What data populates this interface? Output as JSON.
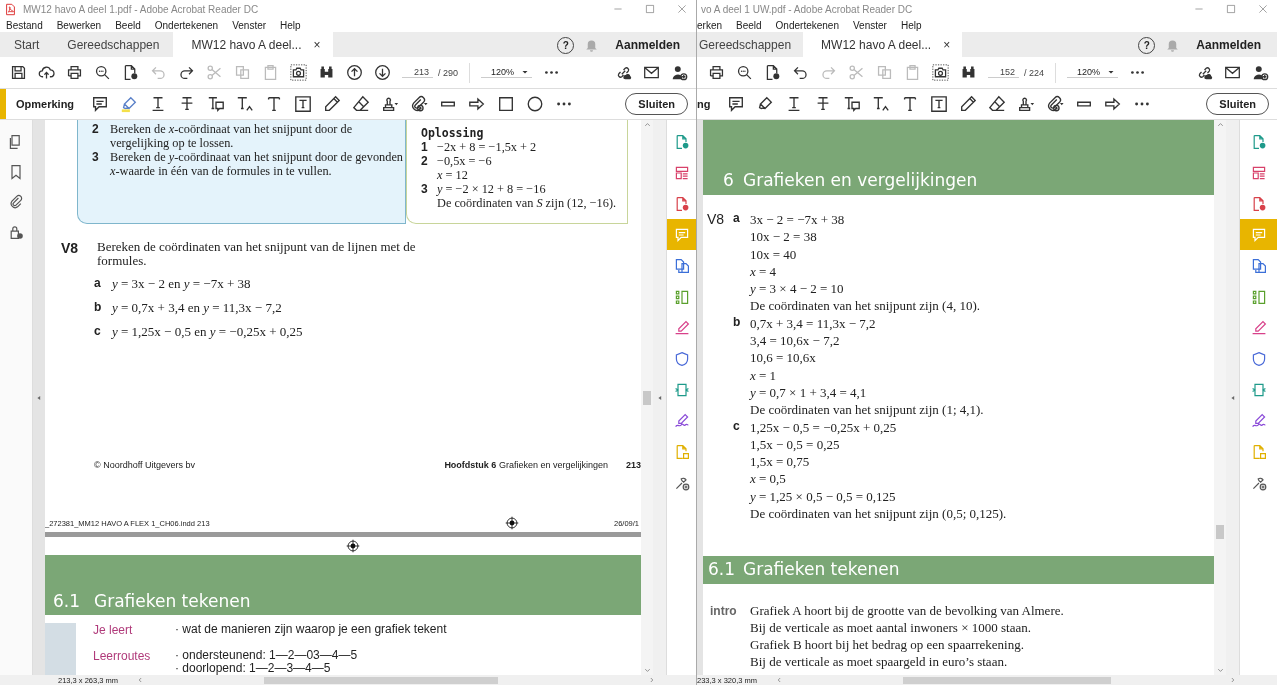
{
  "windows": [
    {
      "title": "MW12 havo A deel 1.pdf - Adobe Acrobat Reader DC",
      "app_icon": true,
      "menu": [
        "Bestand",
        "Bewerken",
        "Beeld",
        "Ondertekenen",
        "Venster",
        "Help"
      ],
      "tabs": [
        {
          "label": "Start",
          "selected": false
        },
        {
          "label": "Gereedschappen",
          "selected": false
        },
        {
          "label": "MW12 havo A deel...",
          "selected": true,
          "close": "×"
        }
      ],
      "help": "?",
      "sign_in": "Aanmelden",
      "tools": [
        {
          "kind": "save",
          "disabled": false
        },
        {
          "kind": "upload",
          "disabled": false
        },
        {
          "kind": "print",
          "disabled": false
        },
        {
          "kind": "search",
          "disabled": false
        },
        {
          "kind": "pdfcheck",
          "disabled": false
        },
        {
          "kind": "undo",
          "disabled": true
        },
        {
          "kind": "redo",
          "disabled": false
        },
        {
          "kind": "cut",
          "disabled": true
        },
        {
          "kind": "copy",
          "disabled": true
        },
        {
          "kind": "paste",
          "disabled": true
        },
        {
          "kind": "snapshot",
          "disabled": false
        },
        {
          "kind": "find",
          "disabled": false
        },
        {
          "kind": "prev",
          "disabled": false
        },
        {
          "kind": "next",
          "disabled": false
        }
      ],
      "page": "213",
      "page_count": "/ 290",
      "zoom": "120%",
      "comment_toolbar": {
        "label": "Opmerking",
        "marker": true,
        "close": "Sluiten"
      },
      "annotation_tools": [
        {
          "kind": "comment",
          "selected": false
        },
        {
          "kind": "highlight",
          "selected": true
        },
        {
          "kind": "underline",
          "selected": false
        },
        {
          "kind": "strike",
          "selected": false
        },
        {
          "kind": "replace",
          "selected": false
        },
        {
          "kind": "insert",
          "selected": false
        },
        {
          "kind": "text",
          "selected": false
        },
        {
          "kind": "textbox",
          "selected": false
        },
        {
          "kind": "pencil",
          "selected": false
        },
        {
          "kind": "eraser",
          "selected": false
        },
        {
          "kind": "stamp",
          "selected": false
        },
        {
          "kind": "attach",
          "selected": false
        },
        {
          "kind": "line",
          "selected": false
        },
        {
          "kind": "arrow",
          "selected": false
        },
        {
          "kind": "rect",
          "selected": false
        },
        {
          "kind": "ellipse",
          "selected": false
        },
        {
          "kind": "more",
          "selected": false
        }
      ],
      "nav_pane": [
        {
          "kind": "pages"
        },
        {
          "kind": "bookmark"
        },
        {
          "kind": "clip"
        },
        {
          "kind": "security"
        }
      ],
      "tool_pane": [
        {
          "kind": "export",
          "selected": false
        },
        {
          "kind": "edit",
          "selected": false
        },
        {
          "kind": "create",
          "selected": false
        },
        {
          "kind": "comment",
          "selected": true
        },
        {
          "kind": "combine",
          "selected": false
        },
        {
          "kind": "organize",
          "selected": false
        },
        {
          "kind": "fill",
          "selected": false
        },
        {
          "kind": "protect",
          "selected": false
        },
        {
          "kind": "optimize",
          "selected": false
        },
        {
          "kind": "sign",
          "selected": false
        },
        {
          "kind": "moretools",
          "selected": false
        },
        {
          "kind": "custom",
          "selected": false
        }
      ],
      "status": "213,3 x 263,3 mm",
      "document": {
        "kind": "textbook",
        "steps": [
          {
            "num": "2",
            "text": "Bereken de *x*-coördinaat van het snijpunt door de vergelijking op te lossen."
          },
          {
            "num": "3",
            "text": "Bereken de *y*-coördinaat van het snijpunt door de gevonden *x*-waarde in één van de formules in te vullen."
          }
        ],
        "solution": {
          "title": "Oplossing",
          "lines": [
            {
              "num": "1",
              "text": "−2x + 8 = −1,5x + 2"
            },
            {
              "num": "2",
              "text": "−0,5x = −6"
            },
            {
              "text": "*x* = 12"
            },
            {
              "num": "3",
              "text": "*y* = −2 × 12 + 8 = −16"
            },
            {
              "text": "De coördinaten van *S* zijn (12, −16)."
            }
          ]
        },
        "exercise": {
          "number": "V8",
          "text": "Bereken de coördinaten van het snijpunt van de lijnen met de formules.",
          "parts": [
            {
              "letter": "a",
              "text": "*y* = 3x − 2 en *y* = −7x + 38"
            },
            {
              "letter": "b",
              "text": "*y* = 0,7x + 3,4 en *y* = 11,3x − 7,2"
            },
            {
              "letter": "c",
              "text": "*y* = 1,25x − 0,5 en *y* = −0,25x + 0,25"
            }
          ]
        },
        "footer": {
          "copyright": "© Noordhoff Uitgevers bv",
          "chapter": "**Hoofdstuk 6** Grafieken en vergelijkingen",
          "page": "213"
        },
        "slug": {
          "file": "_272381_MM12 HAVO A FLEX 1_CH06.indd   213",
          "date": "26/09/1"
        },
        "section": {
          "number": "6.1",
          "title": "Grafieken tekenen"
        },
        "goals": [
          {
            "label": "Je leert",
            "lines": [
              "· wat de manieren zijn waarop je een grafiek tekent"
            ]
          },
          {
            "label": "Leerroutes",
            "lines": [
              "· ondersteunend: 1—2—03—4—5",
              "· doorlopend:       1—2—3—4—5"
            ]
          }
        ]
      }
    },
    {
      "title": "vo A deel 1 UW.pdf - Adobe Acrobat Reader DC",
      "app_icon": false,
      "menu": [
        "erken",
        "Beeld",
        "Ondertekenen",
        "Venster",
        "Help"
      ],
      "tabs": [
        {
          "label": "Gereedschappen",
          "selected": false
        },
        {
          "label": "MW12 havo A deel...",
          "selected": true,
          "close": "×"
        }
      ],
      "help": "?",
      "sign_in": "Aanmelden",
      "tools": [
        {
          "kind": "print",
          "disabled": false
        },
        {
          "kind": "search",
          "disabled": false
        },
        {
          "kind": "pdfcheck",
          "disabled": false
        },
        {
          "kind": "undo",
          "disabled": false
        },
        {
          "kind": "redo",
          "disabled": true
        },
        {
          "kind": "cut",
          "disabled": true
        },
        {
          "kind": "copy",
          "disabled": true
        },
        {
          "kind": "paste",
          "disabled": true
        },
        {
          "kind": "snapshot",
          "disabled": false
        },
        {
          "kind": "find",
          "disabled": false
        }
      ],
      "page": "152",
      "page_count": "/ 224",
      "zoom": "120%",
      "comment_toolbar": {
        "label": "ng",
        "marker": false,
        "close": "Sluiten"
      },
      "annotation_tools": [
        {
          "kind": "comment",
          "selected": false
        },
        {
          "kind": "highlight",
          "selected": false
        },
        {
          "kind": "underline",
          "selected": false
        },
        {
          "kind": "strike",
          "selected": false
        },
        {
          "kind": "replace",
          "selected": false
        },
        {
          "kind": "insert",
          "selected": false
        },
        {
          "kind": "text",
          "selected": false
        },
        {
          "kind": "textbox",
          "selected": false
        },
        {
          "kind": "pencil",
          "selected": false
        },
        {
          "kind": "eraser",
          "selected": false
        },
        {
          "kind": "stamp",
          "selected": false
        },
        {
          "kind": "attach",
          "selected": false
        },
        {
          "kind": "line",
          "selected": false
        },
        {
          "kind": "arrow",
          "selected": false
        },
        {
          "kind": "more",
          "selected": false
        }
      ],
      "tool_pane": [
        {
          "kind": "export",
          "selected": false
        },
        {
          "kind": "edit",
          "selected": false
        },
        {
          "kind": "create",
          "selected": false
        },
        {
          "kind": "comment",
          "selected": true
        },
        {
          "kind": "combine",
          "selected": false
        },
        {
          "kind": "organize",
          "selected": false
        },
        {
          "kind": "fill",
          "selected": false
        },
        {
          "kind": "protect",
          "selected": false
        },
        {
          "kind": "optimize",
          "selected": false
        },
        {
          "kind": "sign",
          "selected": false
        },
        {
          "kind": "moretools",
          "selected": false
        },
        {
          "kind": "custom",
          "selected": false
        }
      ],
      "status": "233,3 x 320,3 mm",
      "document": {
        "kind": "answers",
        "chapter": {
          "number": "6",
          "title": "Grafieken en vergelijkingen"
        },
        "answer": {
          "number": "V8",
          "parts": [
            {
              "letter": "a",
              "lines": [
                "3x − 2 = −7x + 38",
                "10x − 2 = 38",
                "10x = 40",
                "*x* = 4",
                "*y* = 3 × 4 − 2 = 10",
                "De coördinaten van het snijpunt zijn (4, 10)."
              ]
            },
            {
              "letter": "b",
              "lines": [
                "0,7x + 3,4 = 11,3x − 7,2",
                "3,4 = 10,6x − 7,2",
                "10,6 = 10,6x",
                "*x* = 1",
                "*y* = 0,7 × 1 + 3,4 = 4,1",
                "De coördinaten van het snijpunt zijn (1; 4,1)."
              ]
            },
            {
              "letter": "c",
              "lines": [
                "1,25x − 0,5 = −0,25x + 0,25",
                "1,5x − 0,5 = 0,25",
                "1,5x = 0,75",
                "*x* = 0,5",
                "*y* = 1,25 × 0,5 − 0,5 = 0,125",
                "De coördinaten van het snijpunt zijn (0,5; 0,125)."
              ]
            }
          ]
        },
        "section": {
          "number": "6.1",
          "title": "Grafieken tekenen"
        },
        "intro": {
          "label": "intro",
          "lines": [
            "Grafiek A hoort bij de grootte van de bevolking van Almere.",
            "Bij de verticale as moet aantal inwoners × 1000 staan.",
            "Grafiek B hoort bij het bedrag op een spaarrekening.",
            "Bij de verticale as moet spaargeld in euro’s staan."
          ]
        }
      }
    }
  ]
}
